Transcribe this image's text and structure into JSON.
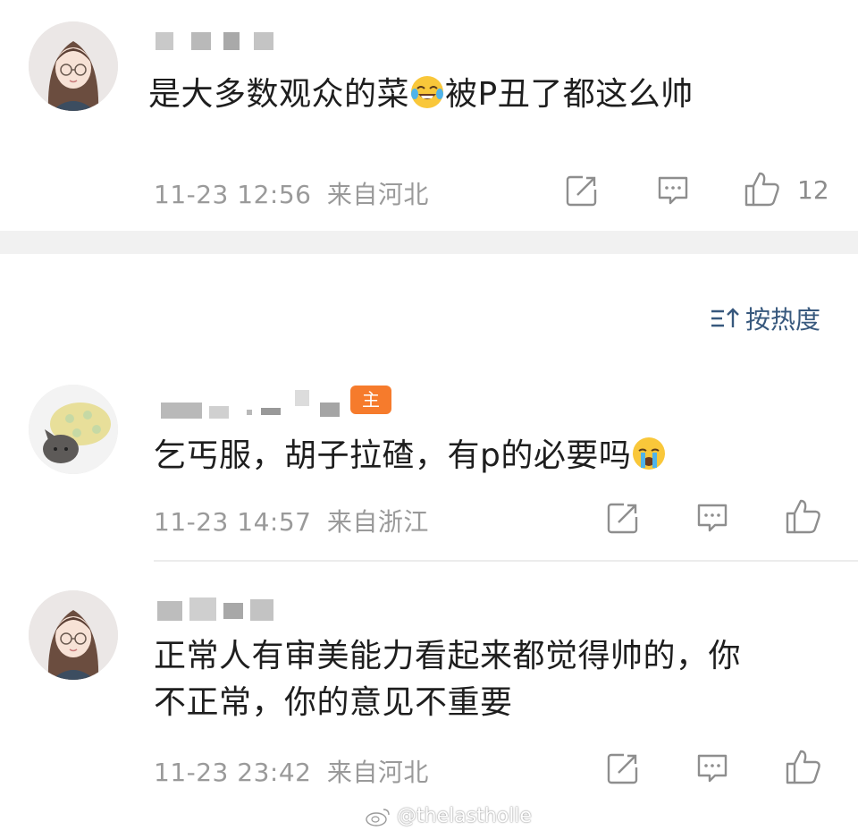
{
  "comments": [
    {
      "avatar_icon": "girl-with-glasses-avatar-icon",
      "text_before_emoji": "是大多数观众的菜",
      "emoji": "laughing-tears-emoji-icon",
      "text_after_emoji": "被P丑了都这么帅",
      "timestamp": "11-23 12:56",
      "location": "来自河北",
      "like_count": "12"
    },
    {
      "avatar_icon": "cat-in-sweater-avatar-icon",
      "badge": "主",
      "text_before_emoji": "乞丐服，胡子拉碴，有p的必要吗",
      "emoji": "crying-emoji-icon",
      "timestamp": "11-23 14:57",
      "location": "来自浙江"
    },
    {
      "avatar_icon": "girl-with-glasses-avatar-icon",
      "text_line1": "正常人有审美能力看起来都觉得帅的，你",
      "text_line2": "不正常，你的意见不重要",
      "timestamp": "11-23 23:42",
      "location": "来自河北"
    }
  ],
  "sort": {
    "label": "按热度",
    "icon": "sort-icon"
  },
  "watermark": {
    "text": "@thelastholle",
    "icon": "weibo-logo-icon"
  },
  "colors": {
    "link": "#37587d",
    "meta": "#9a9a9a",
    "badge": "#f67b2c",
    "separator": "#f1f1f1"
  }
}
